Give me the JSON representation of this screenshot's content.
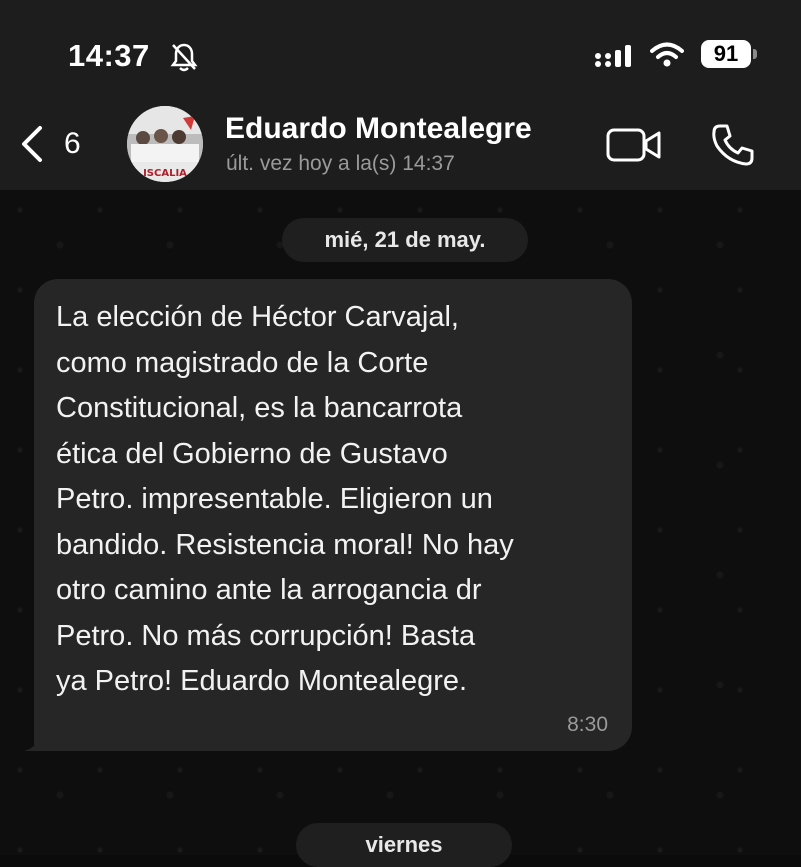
{
  "status_bar": {
    "time": "14:37",
    "battery": "91",
    "icons": [
      "bell-slash-icon",
      "cellular-signal-icon",
      "wifi-icon",
      "battery-icon"
    ]
  },
  "header": {
    "back_count": "6",
    "contact_name": "Eduardo Montealegre",
    "last_seen": "últ. vez hoy a la(s) 14:37",
    "avatar_text": "ISCALIA",
    "icons": [
      "chevron-left-icon",
      "video-call-icon",
      "phone-icon"
    ]
  },
  "chat": {
    "date_separator": "mié, 21 de may.",
    "message": {
      "text": "La elección de Héctor Carvajal,\ncomo magistrado de la Corte\nConstitucional, es la bancarrota\nética del Gobierno de Gustavo\nPetro. impresentable. Eligieron un\nbandido. Resistencia moral! No hay\notro camino ante la arrogancia dr\nPetro. No más corrupción! Basta\nya Petro! Eduardo Montealegre.",
      "time": "8:30"
    },
    "next_date_separator": "viernes"
  },
  "colors": {
    "header_bg": "#1d1d1d",
    "bubble_bg": "#262626",
    "chat_bg": "#0e0e0e",
    "secondary_text": "#9a9a9a"
  }
}
